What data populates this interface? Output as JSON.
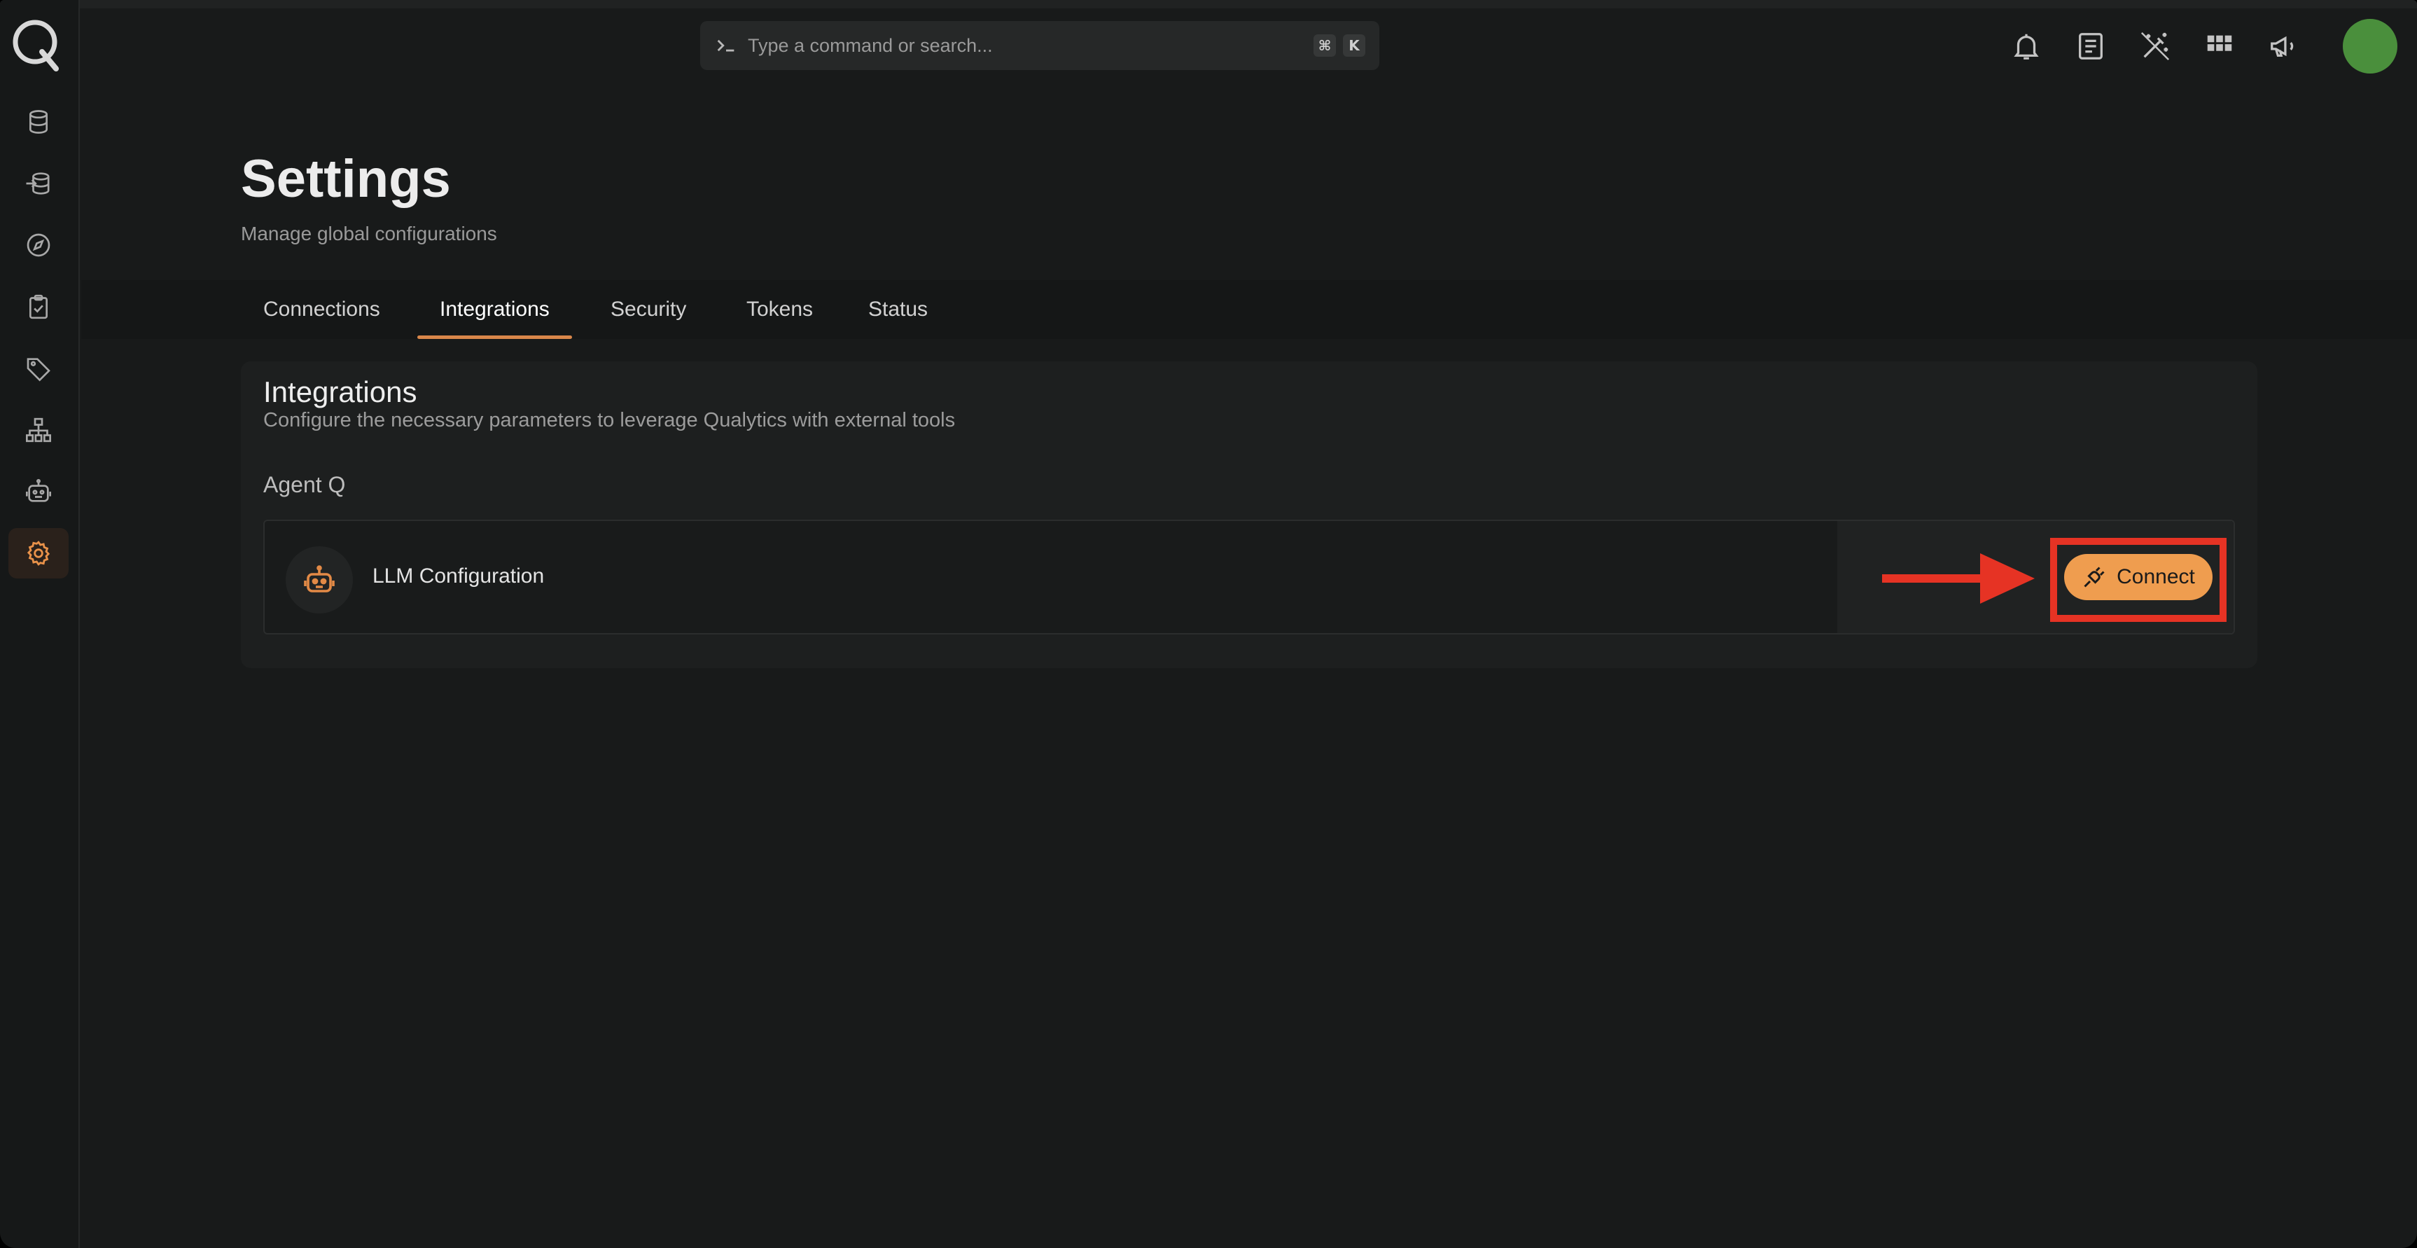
{
  "search": {
    "placeholder": "Type a command or search...",
    "shortcut_mod": "⌘",
    "shortcut_key": "K"
  },
  "page": {
    "title": "Settings",
    "subtitle": "Manage global configurations"
  },
  "tabs": [
    {
      "label": "Connections",
      "active": false
    },
    {
      "label": "Integrations",
      "active": true
    },
    {
      "label": "Security",
      "active": false
    },
    {
      "label": "Tokens",
      "active": false
    },
    {
      "label": "Status",
      "active": false
    }
  ],
  "panel": {
    "title": "Integrations",
    "description": "Configure the necessary parameters to leverage Qualytics with external tools",
    "section": "Agent Q",
    "item": {
      "label": "LLM Configuration",
      "icon": "robot-icon",
      "button_label": "Connect",
      "button_icon": "plug-icon"
    }
  },
  "sidebar_icons": [
    "database-icon",
    "import-database-icon",
    "compass-icon",
    "clipboard-check-icon",
    "tag-icon",
    "sitemap-icon",
    "robot-icon",
    "gear-icon"
  ],
  "sidebar_active": "gear-icon",
  "header_icons": [
    "bell-icon",
    "document-icon",
    "magic-wand-icon",
    "apps-grid-icon",
    "megaphone-icon"
  ],
  "colors": {
    "accent": "#ef9d4f",
    "annotation": "#e63324",
    "avatar": "#4a8f3c",
    "background": "#181a1a"
  }
}
